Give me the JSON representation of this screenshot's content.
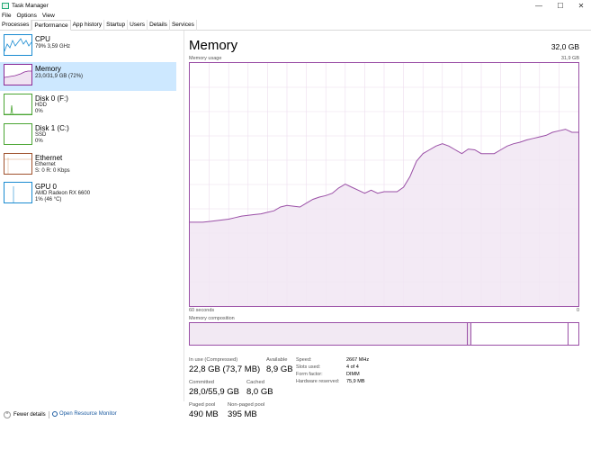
{
  "window": {
    "title": "Task Manager",
    "minimize": "—",
    "maximize": "☐",
    "close": "✕"
  },
  "menu": [
    "File",
    "Options",
    "View"
  ],
  "tabs": [
    "Processes",
    "Performance",
    "App history",
    "Startup",
    "Users",
    "Details",
    "Services"
  ],
  "active_tab": "Performance",
  "sidebar": {
    "items": [
      {
        "name": "CPU",
        "line1": "79%  3,59 GHz",
        "line2": "",
        "color": "#1a8bd1"
      },
      {
        "name": "Memory",
        "line1": "23,0/31,9 GB (72%)",
        "line2": "",
        "color": "#8b2a96"
      },
      {
        "name": "Disk 0 (F:)",
        "line1": "HDD",
        "line2": "0%",
        "color": "#4aa532"
      },
      {
        "name": "Disk 1 (C:)",
        "line1": "SSD",
        "line2": "0%",
        "color": "#4aa532"
      },
      {
        "name": "Ethernet",
        "line1": "Ethernet",
        "line2": "S: 0  R: 0 Kbps",
        "color": "#a0522d"
      },
      {
        "name": "GPU 0",
        "line1": "AMD Radeon RX 6600",
        "line2": "1%  (46 °C)",
        "color": "#1a8bd1"
      }
    ]
  },
  "main": {
    "title": "Memory",
    "total": "32,0 GB",
    "usage_label": "Memory usage",
    "usage_max": "31,9 GB",
    "axis_left": "60 seconds",
    "axis_right": "0",
    "composition_label": "Memory composition",
    "accent": "#9a4fa6"
  },
  "chart_data": {
    "type": "area",
    "ylim": [
      0,
      31.9
    ],
    "x": [
      0,
      1,
      2,
      3,
      4,
      5,
      6,
      7,
      8,
      9,
      10,
      11,
      12,
      13,
      14,
      15,
      16,
      17,
      18,
      19,
      20,
      21,
      22,
      23,
      24,
      25,
      26,
      27,
      28,
      29,
      30,
      31,
      32,
      33,
      34,
      35,
      36,
      37,
      38,
      39,
      40,
      41,
      42,
      43,
      44,
      45,
      46,
      47,
      48,
      49,
      50,
      51,
      52,
      53,
      54,
      55,
      56,
      57,
      58,
      59,
      60
    ],
    "series": [
      {
        "values": [
          11.0,
          11.0,
          11.0,
          11.1,
          11.2,
          11.3,
          11.4,
          11.6,
          11.8,
          11.9,
          12.0,
          12.1,
          12.3,
          12.5,
          13.0,
          13.2,
          13.1,
          13.0,
          13.5,
          14.0,
          14.3,
          14.5,
          14.8,
          15.5,
          16.0,
          15.6,
          15.2,
          14.8,
          15.2,
          14.8,
          15.0,
          15.0,
          15.0,
          15.6,
          17.0,
          19.0,
          20.0,
          20.5,
          21.0,
          21.3,
          21.0,
          20.5,
          20.0,
          20.6,
          20.5,
          20.0,
          20.0,
          20.0,
          20.5,
          21.0,
          21.3,
          21.5,
          21.8,
          22.0,
          22.2,
          22.4,
          22.8,
          23.0,
          23.2,
          22.8,
          22.8
        ]
      }
    ],
    "composition": {
      "in_use": 22.8,
      "modified": 0.3,
      "standby": 8.0,
      "total": 31.9
    }
  },
  "stats": {
    "in_use_label": "In use (Compressed)",
    "in_use_value": "22,8 GB (73,7 MB)",
    "available_label": "Available",
    "available_value": "8,9 GB",
    "committed_label": "Committed",
    "committed_value": "28,0/55,9 GB",
    "cached_label": "Cached",
    "cached_value": "8,0 GB",
    "paged_label": "Paged pool",
    "paged_value": "490 MB",
    "nonpaged_label": "Non-paged pool",
    "nonpaged_value": "395 MB"
  },
  "hardware": [
    {
      "label": "Speed:",
      "value": "2667 MHz"
    },
    {
      "label": "Slots used:",
      "value": "4 of 4"
    },
    {
      "label": "Form factor:",
      "value": "DIMM"
    },
    {
      "label": "Hardware reserved:",
      "value": "75,9 MB"
    }
  ],
  "footer": {
    "fewer_details": "Fewer details",
    "open_monitor": "Open Resource Monitor"
  }
}
